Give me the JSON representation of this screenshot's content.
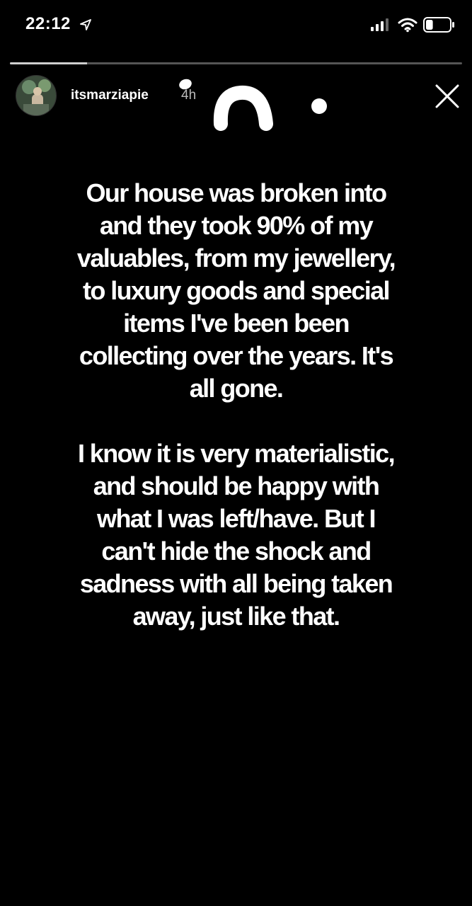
{
  "status_bar": {
    "time": "22:12",
    "location_icon": "location-arrow-icon",
    "signal_icon": "cellular-signal-icon",
    "wifi_icon": "wifi-icon",
    "battery_icon": "battery-icon",
    "battery_level": 0.3
  },
  "story": {
    "progress": 0.17,
    "username": "itsmarziapie",
    "time_ago": "4h",
    "paragraphs": [
      "Our house was broken into and they took 90% of my valuables, from my jewellery, to luxury goods and special items I've been been collecting over the years. It's all gone.",
      "I know it is very materialistic, and should be happy with what I was left/have. But I can't hide the shock and sadness with all being taken away, just like that."
    ]
  },
  "colors": {
    "background": "#000000",
    "text": "#ffffff",
    "progress_track": "#555555",
    "progress_fill": "#cfcfcf"
  },
  "icons": {
    "close": "close-icon",
    "avatar": "avatar"
  }
}
